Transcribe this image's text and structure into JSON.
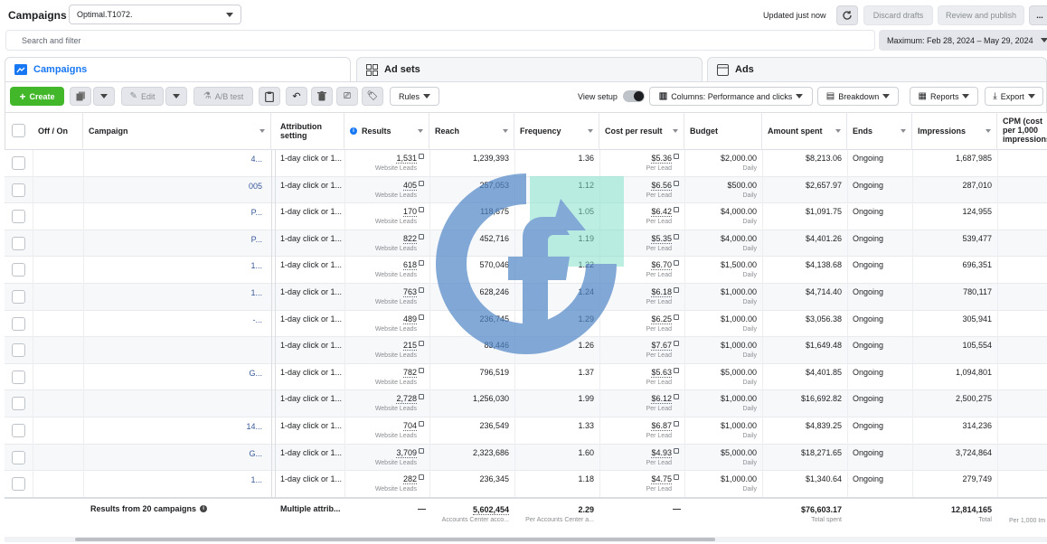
{
  "header": {
    "title": "Campaigns",
    "account": "Optimal.T1072.",
    "status": "Updated just now",
    "discard_label": "Discard drafts",
    "review_label": "Review and publish",
    "more": "..."
  },
  "search": {
    "placeholder": "Search and filter"
  },
  "date_range": "Maximum: Feb 28, 2024 – May 29, 2024",
  "tabs": [
    {
      "label": "Campaigns"
    },
    {
      "label": "Ad sets"
    },
    {
      "label": "Ads"
    }
  ],
  "toolbar": {
    "create": "Create",
    "edit": "Edit",
    "ab_test": "A/B test",
    "rules": "Rules",
    "view_setup": "View setup",
    "columns": "Columns: Performance and clicks",
    "breakdown": "Breakdown",
    "reports": "Reports",
    "export": "Export"
  },
  "columns": [
    "Off / On",
    "Campaign",
    "Attribution setting",
    "Results",
    "Reach",
    "Frequency",
    "Cost per result",
    "Budget",
    "Amount spent",
    "Ends",
    "Impressions",
    "CPM (cost per 1,000 impressions)"
  ],
  "rows": [
    {
      "campaign": "4...",
      "attribution": "1-day click or 1...",
      "results": "1,531",
      "results_type": "Website Leads",
      "reach": "1,239,393",
      "frequency": "1.36",
      "cpr": "$5.36",
      "cpr_type": "Per Lead",
      "budget": "$2,000.00",
      "budget_type": "Daily",
      "spent": "$8,213.06",
      "ends": "Ongoing",
      "impressions": "1,687,985"
    },
    {
      "campaign": "005",
      "attribution": "1-day click or 1...",
      "results": "405",
      "results_type": "Website Leads",
      "reach": "257,053",
      "frequency": "1.12",
      "cpr": "$6.56",
      "cpr_type": "Per Lead",
      "budget": "$500.00",
      "budget_type": "Daily",
      "spent": "$2,657.97",
      "ends": "Ongoing",
      "impressions": "287,010"
    },
    {
      "campaign": "P...",
      "attribution": "1-day click or 1...",
      "results": "170",
      "results_type": "Website Leads",
      "reach": "118,675",
      "frequency": "1.05",
      "cpr": "$6.42",
      "cpr_type": "Per Lead",
      "budget": "$4,000.00",
      "budget_type": "Daily",
      "spent": "$1,091.75",
      "ends": "Ongoing",
      "impressions": "124,955"
    },
    {
      "campaign": "P...",
      "attribution": "1-day click or 1...",
      "results": "822",
      "results_type": "Website Leads",
      "reach": "452,716",
      "frequency": "1.19",
      "cpr": "$5.35",
      "cpr_type": "Per Lead",
      "budget": "$4,000.00",
      "budget_type": "Daily",
      "spent": "$4,401.26",
      "ends": "Ongoing",
      "impressions": "539,477"
    },
    {
      "campaign": "1...",
      "attribution": "1-day click or 1...",
      "results": "618",
      "results_type": "Website Leads",
      "reach": "570,046",
      "frequency": "1.22",
      "cpr": "$6.70",
      "cpr_type": "Per Lead",
      "budget": "$1,500.00",
      "budget_type": "Daily",
      "spent": "$4,138.68",
      "ends": "Ongoing",
      "impressions": "696,351"
    },
    {
      "campaign": "1...",
      "attribution": "1-day click or 1...",
      "results": "763",
      "results_type": "Website Leads",
      "reach": "628,246",
      "frequency": "1.24",
      "cpr": "$6.18",
      "cpr_type": "Per Lead",
      "budget": "$1,000.00",
      "budget_type": "Daily",
      "spent": "$4,714.40",
      "ends": "Ongoing",
      "impressions": "780,117"
    },
    {
      "campaign": "-...",
      "attribution": "1-day click or 1...",
      "results": "489",
      "results_type": "Website Leads",
      "reach": "236,745",
      "frequency": "1.29",
      "cpr": "$6.25",
      "cpr_type": "Per Lead",
      "budget": "$1,000.00",
      "budget_type": "Daily",
      "spent": "$3,056.38",
      "ends": "Ongoing",
      "impressions": "305,941"
    },
    {
      "campaign": "",
      "attribution": "1-day click or 1...",
      "results": "215",
      "results_type": "Website Leads",
      "reach": "83,446",
      "frequency": "1.26",
      "cpr": "$7.67",
      "cpr_type": "Per Lead",
      "budget": "$1,000.00",
      "budget_type": "Daily",
      "spent": "$1,649.48",
      "ends": "Ongoing",
      "impressions": "105,554"
    },
    {
      "campaign": "G...",
      "attribution": "1-day click or 1...",
      "results": "782",
      "results_type": "Website Leads",
      "reach": "796,519",
      "frequency": "1.37",
      "cpr": "$5.63",
      "cpr_type": "Per Lead",
      "budget": "$5,000.00",
      "budget_type": "Daily",
      "spent": "$4,401.85",
      "ends": "Ongoing",
      "impressions": "1,094,801"
    },
    {
      "campaign": "",
      "attribution": "1-day click or 1...",
      "results": "2,728",
      "results_type": "Website Leads",
      "reach": "1,256,030",
      "frequency": "1.99",
      "cpr": "$6.12",
      "cpr_type": "Per Lead",
      "budget": "$1,000.00",
      "budget_type": "Daily",
      "spent": "$16,692.82",
      "ends": "Ongoing",
      "impressions": "2,500,275"
    },
    {
      "campaign": "14...",
      "attribution": "1-day click or 1...",
      "results": "704",
      "results_type": "Website Leads",
      "reach": "236,549",
      "frequency": "1.33",
      "cpr": "$6.87",
      "cpr_type": "Per Lead",
      "budget": "$1,000.00",
      "budget_type": "Daily",
      "spent": "$4,839.25",
      "ends": "Ongoing",
      "impressions": "314,236"
    },
    {
      "campaign": "G...",
      "attribution": "1-day click or 1...",
      "results": "3,709",
      "results_type": "Website Leads",
      "reach": "2,323,686",
      "frequency": "1.60",
      "cpr": "$4.93",
      "cpr_type": "Per Lead",
      "budget": "$5,000.00",
      "budget_type": "Daily",
      "spent": "$18,271.65",
      "ends": "Ongoing",
      "impressions": "3,724,864"
    },
    {
      "campaign": "1...",
      "attribution": "1-day click or 1...",
      "results": "282",
      "results_type": "Website Leads",
      "reach": "236,345",
      "frequency": "1.18",
      "cpr": "$4.75",
      "cpr_type": "Per Lead",
      "budget": "$1,000.00",
      "budget_type": "Daily",
      "spent": "$1,340.64",
      "ends": "Ongoing",
      "impressions": "279,749"
    }
  ],
  "totals": {
    "label": "Results from 20 campaigns",
    "attribution": "Multiple attrib...",
    "results": "—",
    "reach": "5,602,454",
    "reach_sub": "Accounts Center acco...",
    "frequency": "2.29",
    "frequency_sub": "Per Accounts Center a...",
    "cpr": "—",
    "spent": "$76,603.17",
    "spent_sub": "Total spent",
    "impressions": "12,814,165",
    "impressions_sub": "Total",
    "cpm_sub": "Per 1,000 Im"
  },
  "colors": {
    "accent": "#1877f2",
    "create": "#42b72a",
    "link": "#385898"
  }
}
